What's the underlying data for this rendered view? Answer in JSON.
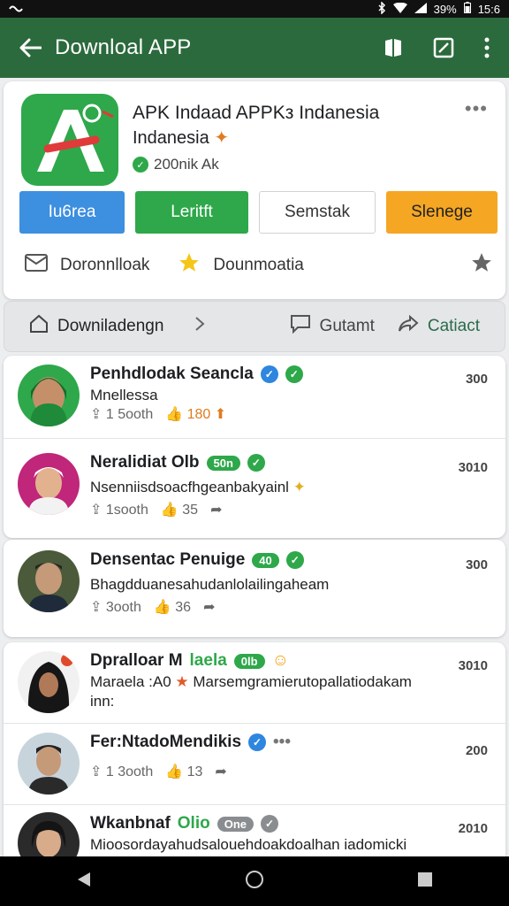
{
  "status_bar": {
    "left_icon": "notification-icon",
    "battery": "39%",
    "time": "15:6"
  },
  "appbar": {
    "title": "Downloal APP"
  },
  "app": {
    "name": "APK Indaad APPKз Indanesia",
    "subtitle": "Indanesia",
    "meta": "200nik Ak",
    "buttons": [
      "Iu6rea",
      "Leritft",
      "Semstak",
      "Slenege"
    ],
    "download_label": "Doronnlloak",
    "favorite_label": "Dounmoatia"
  },
  "nav": {
    "left_label": "Downiladengn",
    "comment_label": "Gutamt",
    "share_label": "Catiact"
  },
  "posts": [
    {
      "name": "Penhdlodak Seancla",
      "line1": "Mnellessа",
      "stats": "1 5ooth",
      "likes": "180",
      "count": "300"
    },
    {
      "name": "Neralidiat Olb",
      "tag": "50n",
      "text": "Nsenniisdsoacfhgeanbakyainl",
      "stats": "1sooth",
      "likes": "35",
      "count": "3010"
    },
    {
      "name": "Densentac Penuige",
      "tag": "40",
      "text": "Bhagdduanesahudanlolailingaheam",
      "stats": "3ooth",
      "likes": "36",
      "count": "300"
    },
    {
      "name": "Dpralloar M",
      "name_tail": "laela",
      "tag": "0lb",
      "text": "Maraela :A0",
      "text_tail": "Marsemgramierutopallatiodakam",
      "line3": "inn:",
      "count": "3010"
    },
    {
      "name": "Fer:NtadoMendikis",
      "stats": "1 3ooth",
      "likes": "13",
      "count": "200"
    },
    {
      "name": "Wkanbnaf",
      "name_tail": "Olio",
      "tag": "One",
      "text": "Mioosordayahudsalouehdoakdoalhan iadomicki",
      "count": "2010"
    }
  ],
  "colors": {
    "appbar": "#2b6a3c",
    "accent_green": "#2ea84a",
    "blue": "#3d8fe0",
    "orange": "#f5a623"
  }
}
